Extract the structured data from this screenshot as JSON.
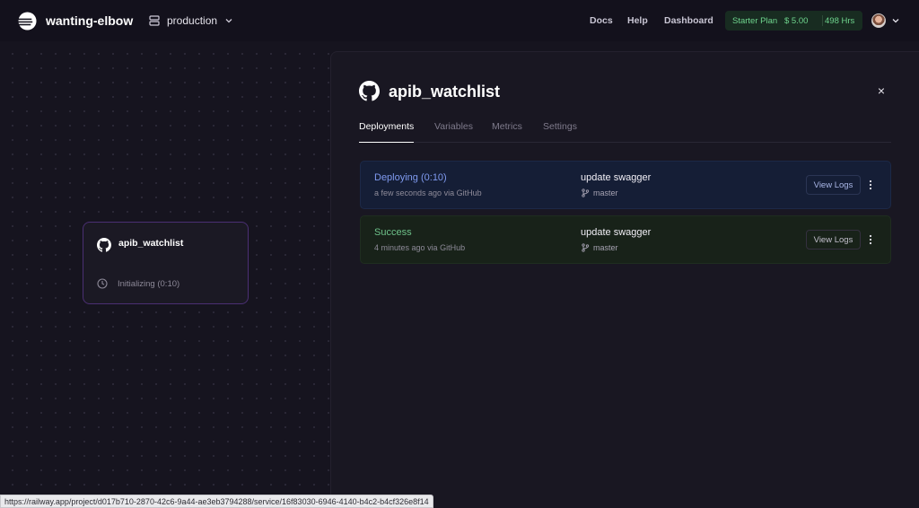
{
  "header": {
    "project_name": "wanting-elbow",
    "environment": "production",
    "nav": [
      "Docs",
      "Help",
      "Dashboard"
    ],
    "plan": {
      "name": "Starter Plan",
      "cost": "$ 5.00",
      "hours": "498 Hrs"
    }
  },
  "service_card": {
    "title": "apib_watchlist",
    "status": "Initializing (0:10)"
  },
  "panel": {
    "title": "apib_watchlist",
    "tabs": [
      "Deployments",
      "Variables",
      "Metrics",
      "Settings"
    ],
    "active_tab": "Deployments",
    "deployments": [
      {
        "status": "Deploying (0:10)",
        "time": "a few seconds ago",
        "via": "via GitHub",
        "message": "update swagger",
        "branch": "master",
        "action": "View Logs"
      },
      {
        "status": "Success",
        "time": "4 minutes ago",
        "via": "via GitHub",
        "message": "update swagger",
        "branch": "master",
        "action": "View Logs"
      }
    ]
  },
  "status_bar_url": "https://railway.app/project/d017b710-2870-42c6-9a44-ae3eb3794288/service/16f83030-6946-4140-b4c2-b4cf326e8f14",
  "colors": {
    "background": "#13111c",
    "panel": "#191722",
    "deploying": "#7f9af0",
    "success": "#6ec28a",
    "card_border": "#4b2f73"
  },
  "icons": [
    "railway-logo-icon",
    "environment-icon",
    "chevron-down-icon",
    "github-icon",
    "clock-icon",
    "close-icon",
    "git-branch-icon",
    "kebab-menu-icon"
  ]
}
